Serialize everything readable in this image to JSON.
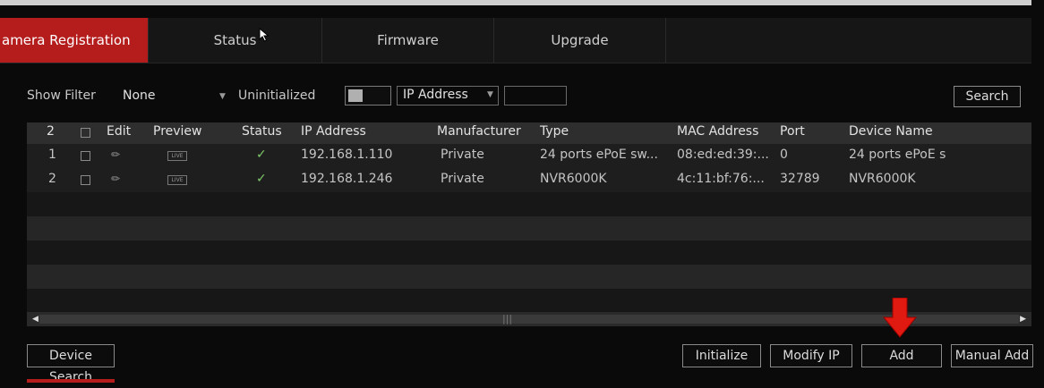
{
  "tabs": [
    {
      "label": "amera Registration",
      "active": true
    },
    {
      "label": "Status",
      "active": false
    },
    {
      "label": "Firmware",
      "active": false
    },
    {
      "label": "Upgrade",
      "active": false
    }
  ],
  "filter": {
    "show_filter_label": "Show Filter",
    "filter_value": "None",
    "uninitialized_label": "Uninitialized",
    "field_value": "IP Address",
    "search_value": "",
    "search_button": "Search"
  },
  "table": {
    "columns": [
      "2",
      "Edit",
      "Preview",
      "Status",
      "IP Address",
      "Manufacturer",
      "Type",
      "MAC Address",
      "Port",
      "Device Name"
    ],
    "rows": [
      {
        "no": "1",
        "ip": "192.168.1.110",
        "manufacturer": "Private",
        "type": "24 ports ePoE sw...",
        "mac": "08:ed:ed:39:...",
        "port": "0",
        "name": "24 ports ePoE s"
      },
      {
        "no": "2",
        "ip": "192.168.1.246",
        "manufacturer": "Private",
        "type": "NVR6000K",
        "mac": "4c:11:bf:76:...",
        "port": "32789",
        "name": "NVR6000K"
      }
    ],
    "live_label": "LIVE",
    "status_icon": "check-icon"
  },
  "buttons": {
    "device_search": "Device Search",
    "initialize": "Initialize",
    "modify_ip": "Modify IP",
    "add": "Add",
    "manual_add": "Manual Add"
  },
  "colors": {
    "accent": "#b51d1d",
    "status_ok": "#7ec96a",
    "arrow": "#e01a10"
  }
}
